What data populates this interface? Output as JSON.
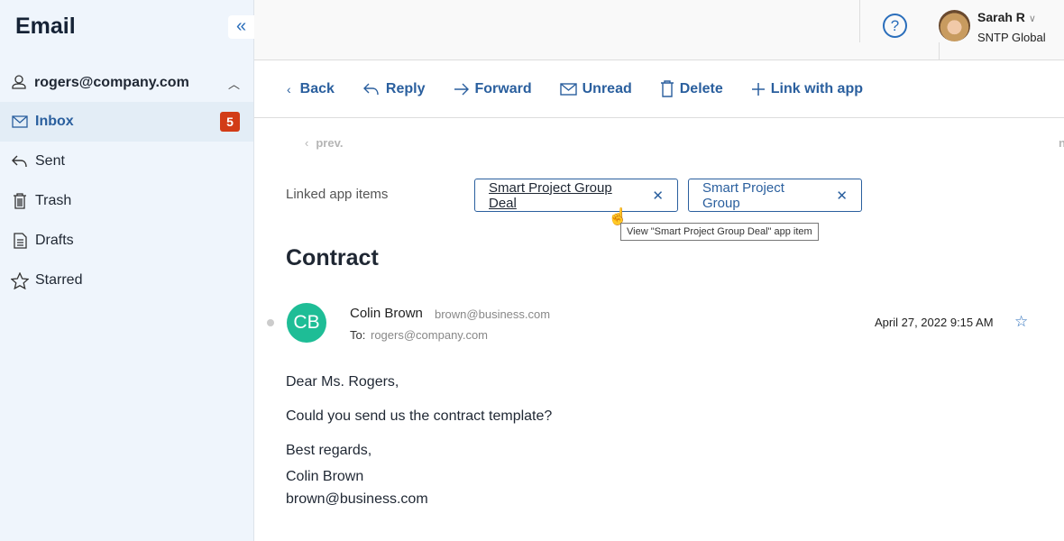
{
  "sidebar": {
    "title": "Email",
    "collapse_icon": "double-chevron-left-icon",
    "account": "rogers@company.com",
    "items": [
      {
        "label": "Inbox",
        "icon": "envelope-icon",
        "badge": "5",
        "active": true
      },
      {
        "label": "Sent",
        "icon": "reply-icon"
      },
      {
        "label": "Trash",
        "icon": "trash-icon"
      },
      {
        "label": "Drafts",
        "icon": "document-icon"
      },
      {
        "label": "Starred",
        "icon": "star-icon"
      }
    ]
  },
  "header": {
    "user_name": "Sarah R",
    "user_org": "SNTP Global",
    "help_icon": "question-icon",
    "help_glyph": "?"
  },
  "toolbar": {
    "back": "Back",
    "reply": "Reply",
    "forward": "Forward",
    "unread": "Unread",
    "delete": "Delete",
    "link": "Link with app"
  },
  "pager": {
    "prev": "prev.",
    "next": "n"
  },
  "linked": {
    "label": "Linked app items",
    "chips": [
      "Smart Project Group Deal",
      "Smart Project Group"
    ],
    "tooltip": "View \"Smart Project Group Deal\" app item"
  },
  "message": {
    "subject": "Contract",
    "sender_initials": "CB",
    "sender_name": "Colin Brown",
    "sender_email": "brown@business.com",
    "to_label": "To:",
    "to": "rogers@company.com",
    "date": "April 27, 2022 9:15 AM",
    "body": [
      "Dear Ms. Rogers,",
      "Could you send us the contract template?",
      "Best regards,",
      "Colin Brown",
      "brown@business.com"
    ]
  },
  "colors": {
    "accent": "#2a5f9e",
    "badge": "#d23c17",
    "avatar": "#1ebd96"
  }
}
